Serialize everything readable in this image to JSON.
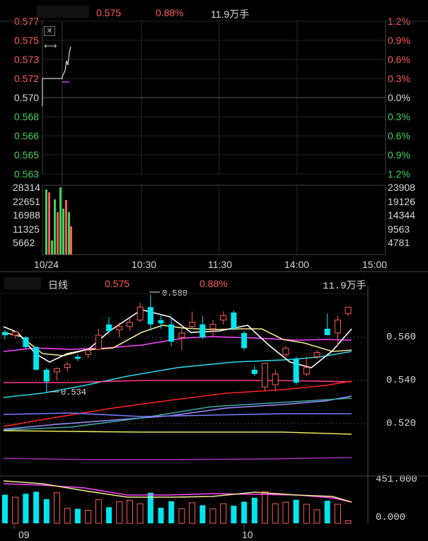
{
  "intraday": {
    "title_placeholder": "",
    "price": "0.575",
    "change_pct": "0.88%",
    "volume": "11.9万手",
    "price_ticks": [
      {
        "v": "0.577",
        "c": "red"
      },
      {
        "v": "0.575",
        "c": "red"
      },
      {
        "v": "0.573",
        "c": "red"
      },
      {
        "v": "0.572",
        "c": "red"
      },
      {
        "v": "0.570",
        "c": "wht"
      },
      {
        "v": "0.568",
        "c": "grn"
      },
      {
        "v": "0.566",
        "c": "grn"
      },
      {
        "v": "0.565",
        "c": "grn"
      },
      {
        "v": "0.563",
        "c": "grn"
      }
    ],
    "pct_ticks": [
      {
        "v": "1.2%",
        "c": "red"
      },
      {
        "v": "0.9%",
        "c": "red"
      },
      {
        "v": "0.6%",
        "c": "red"
      },
      {
        "v": "0.3%",
        "c": "red"
      },
      {
        "v": "0.0%",
        "c": "wht"
      },
      {
        "v": "0.3%",
        "c": "grn"
      },
      {
        "v": "0.6%",
        "c": "grn"
      },
      {
        "v": "0.9%",
        "c": "grn"
      },
      {
        "v": "1.2%",
        "c": "grn"
      }
    ],
    "vol_left": [
      "28314",
      "22651",
      "16988",
      "11325",
      "5662"
    ],
    "vol_right": [
      "23908",
      "19126",
      "14344",
      "9563",
      "4781"
    ],
    "time_labels": [
      "10/24",
      "10:30",
      "11:30",
      "14:00",
      "15:00"
    ],
    "close_icon": "close-icon",
    "resize_icon": "resize-horizontal-icon"
  },
  "daily": {
    "period": "日线",
    "price": "0.575",
    "change_pct": "0.88%",
    "volume": "11.9万手",
    "price_ticks": [
      "0.560",
      "0.540",
      "0.520"
    ],
    "vol_ticks": [
      "451.000",
      "0.000"
    ],
    "high_marker": "0.580",
    "low_marker": "0.534",
    "month_labels": [
      "09",
      "10"
    ]
  },
  "colors": {
    "up": "#ff5a5a",
    "down": "#00e5ee",
    "ma5": "#ffffff",
    "ma10": "#e8e85a",
    "ma20": "#ff44ff",
    "ma30": "#44ff44",
    "ma60": "#ff2222",
    "ma120": "#4ec9ff"
  },
  "chart_data": {
    "type": "candlestick",
    "candles": [
      {
        "o": 0.5625,
        "h": 0.5635,
        "l": 0.559,
        "c": 0.561
      },
      {
        "o": 0.561,
        "h": 0.563,
        "l": 0.5595,
        "c": 0.5625
      },
      {
        "o": 0.56,
        "h": 0.5605,
        "l": 0.5545,
        "c": 0.5555
      },
      {
        "o": 0.5555,
        "h": 0.556,
        "l": 0.5445,
        "c": 0.545
      },
      {
        "o": 0.545,
        "h": 0.546,
        "l": 0.534,
        "c": 0.5395
      },
      {
        "o": 0.544,
        "h": 0.546,
        "l": 0.54,
        "c": 0.5455
      },
      {
        "o": 0.546,
        "h": 0.5485,
        "l": 0.544,
        "c": 0.5475
      },
      {
        "o": 0.551,
        "h": 0.552,
        "l": 0.549,
        "c": 0.55
      },
      {
        "o": 0.552,
        "h": 0.5545,
        "l": 0.5505,
        "c": 0.554
      },
      {
        "o": 0.5545,
        "h": 0.564,
        "l": 0.554,
        "c": 0.561
      },
      {
        "o": 0.566,
        "h": 0.5695,
        "l": 0.562,
        "c": 0.563
      },
      {
        "o": 0.5635,
        "h": 0.567,
        "l": 0.56,
        "c": 0.565
      },
      {
        "o": 0.565,
        "h": 0.569,
        "l": 0.563,
        "c": 0.567
      },
      {
        "o": 0.568,
        "h": 0.576,
        "l": 0.567,
        "c": 0.574
      },
      {
        "o": 0.574,
        "h": 0.58,
        "l": 0.563,
        "c": 0.566
      },
      {
        "o": 0.568,
        "h": 0.57,
        "l": 0.564,
        "c": 0.5665
      },
      {
        "o": 0.566,
        "h": 0.569,
        "l": 0.556,
        "c": 0.558
      },
      {
        "o": 0.56,
        "h": 0.564,
        "l": 0.554,
        "c": 0.562
      },
      {
        "o": 0.565,
        "h": 0.572,
        "l": 0.564,
        "c": 0.567
      },
      {
        "o": 0.566,
        "h": 0.57,
        "l": 0.559,
        "c": 0.56
      },
      {
        "o": 0.564,
        "h": 0.568,
        "l": 0.56,
        "c": 0.566
      },
      {
        "o": 0.568,
        "h": 0.572,
        "l": 0.566,
        "c": 0.57
      },
      {
        "o": 0.5715,
        "h": 0.5725,
        "l": 0.563,
        "c": 0.564
      },
      {
        "o": 0.562,
        "h": 0.563,
        "l": 0.554,
        "c": 0.555
      },
      {
        "o": 0.545,
        "h": 0.547,
        "l": 0.542,
        "c": 0.543
      },
      {
        "o": 0.537,
        "h": 0.548,
        "l": 0.535,
        "c": 0.548
      },
      {
        "o": 0.538,
        "h": 0.545,
        "l": 0.535,
        "c": 0.543
      },
      {
        "o": 0.552,
        "h": 0.556,
        "l": 0.551,
        "c": 0.555
      },
      {
        "o": 0.55,
        "h": 0.551,
        "l": 0.538,
        "c": 0.539
      },
      {
        "o": 0.543,
        "h": 0.551,
        "l": 0.542,
        "c": 0.546
      },
      {
        "o": 0.551,
        "h": 0.554,
        "l": 0.55,
        "c": 0.553
      },
      {
        "o": 0.564,
        "h": 0.571,
        "l": 0.561,
        "c": 0.561
      },
      {
        "o": 0.562,
        "h": 0.57,
        "l": 0.556,
        "c": 0.568
      },
      {
        "o": 0.571,
        "h": 0.574,
        "l": 0.57,
        "c": 0.574
      }
    ],
    "volumes": [
      285,
      260,
      295,
      315,
      240,
      305,
      150,
      145,
      130,
      235,
      160,
      215,
      230,
      195,
      305,
      155,
      220,
      145,
      205,
      180,
      145,
      195,
      175,
      215,
      255,
      315,
      195,
      210,
      235,
      190,
      135,
      225,
      190,
      25
    ]
  }
}
